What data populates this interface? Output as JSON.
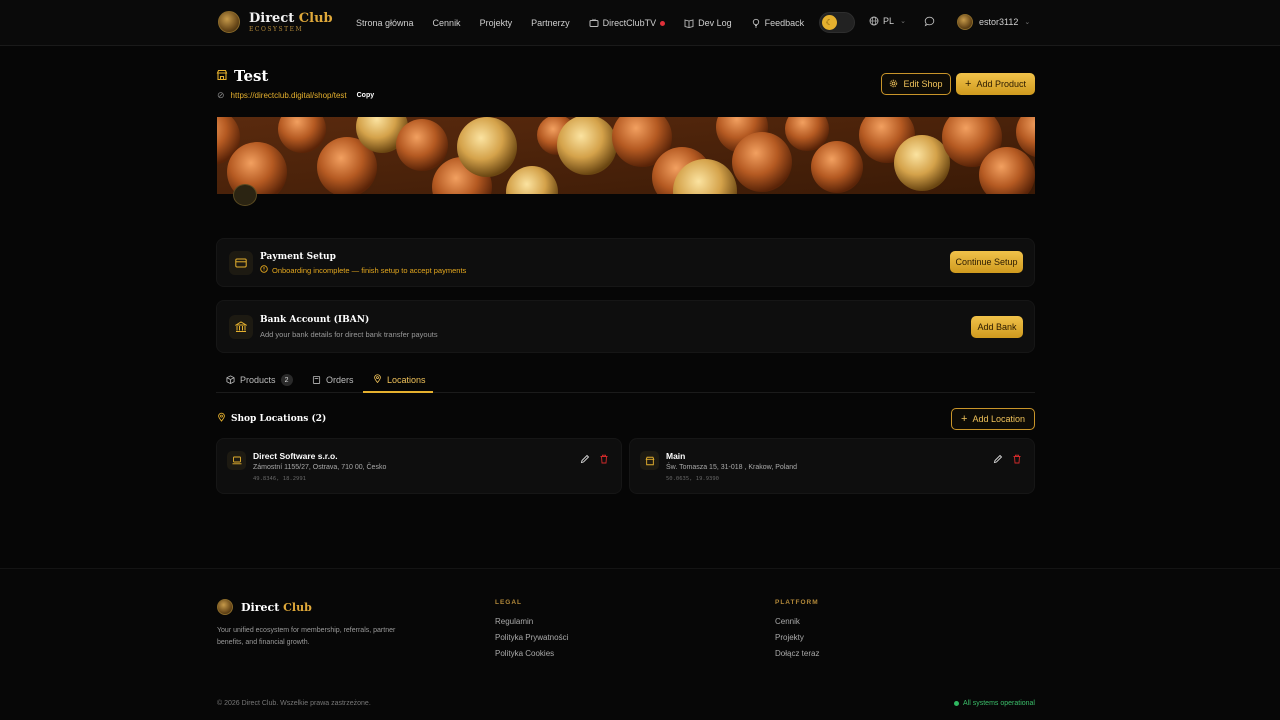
{
  "nav": {
    "brand_name_1": "Direct",
    "brand_name_2": "Club",
    "brand_sub": "ECOSYSTEM",
    "links": [
      {
        "label": "Strona główna"
      },
      {
        "label": "Cennik"
      },
      {
        "label": "Projekty"
      },
      {
        "label": "Partnerzy"
      },
      {
        "label": "DirectClubTV",
        "icon": "tv-icon",
        "live": true
      },
      {
        "label": "Dev Log",
        "icon": "book-icon"
      },
      {
        "label": "Feedback",
        "icon": "lightbulb-icon"
      }
    ],
    "language": "PL",
    "username": "estor3112"
  },
  "shop": {
    "title": "Test",
    "url": "https://directclub.digital/shop/test",
    "copy_label": "Copy",
    "edit_label": "Edit Shop",
    "add_product_label": "Add Product"
  },
  "payment_card": {
    "title": "Payment Setup",
    "status": "Onboarding incomplete — finish setup to accept payments",
    "button": "Continue Setup"
  },
  "bank_card": {
    "title": "Bank Account (IBAN)",
    "subtitle": "Add your bank details for direct bank transfer payouts",
    "button": "Add Bank"
  },
  "tabs": [
    {
      "label": "Products",
      "count": "2"
    },
    {
      "label": "Orders"
    },
    {
      "label": "Locations",
      "active": true
    }
  ],
  "locations": {
    "heading": "Shop Locations (2)",
    "add_label": "Add Location",
    "items": [
      {
        "name": "Direct Software s.r.o.",
        "address": "Zámostní 1155/27, Ostrava, 710 00, Česko",
        "coords": "49.8346, 18.2991"
      },
      {
        "name": "Main",
        "address": "Św. Tomasza 15, 31-018 , Krakow, Poland",
        "coords": "50.0635, 19.9390"
      }
    ]
  },
  "footer": {
    "brand_1": "Direct",
    "brand_2": "Club",
    "description": "Your unified ecosystem for membership, referrals, partner benefits, and financial growth.",
    "legal_head": "LEGAL",
    "legal": [
      "Regulamin",
      "Polityka Prywatności",
      "Polityka Cookies"
    ],
    "platform_head": "PLATFORM",
    "platform": [
      "Cennik",
      "Projekty",
      "Dołącz teraz"
    ],
    "copyright": "© 2026 Direct Club. Wszelkie prawa zastrzeżone.",
    "status": "All systems operational"
  },
  "colors": {
    "accent": "#e5b02e",
    "background": "#060606",
    "danger": "#d22a2a",
    "success": "#2fb860"
  }
}
